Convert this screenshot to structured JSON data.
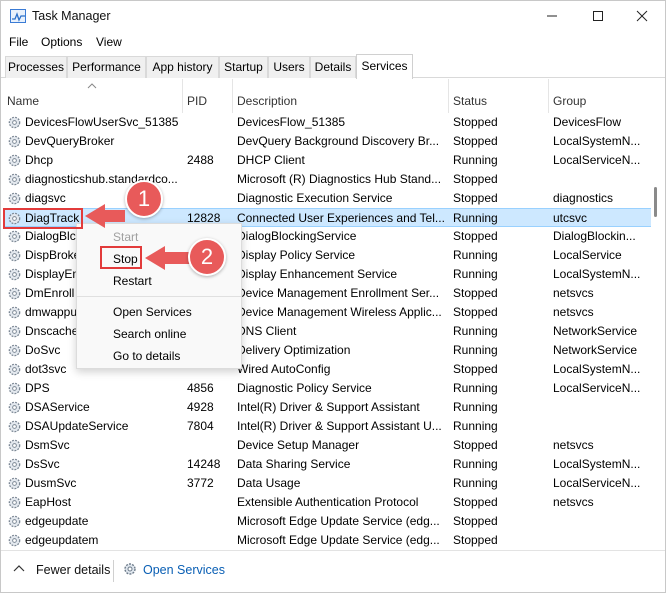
{
  "window": {
    "title": "Task Manager"
  },
  "menu": [
    "File",
    "Options",
    "View"
  ],
  "tabs": [
    {
      "label": "Processes"
    },
    {
      "label": "Performance"
    },
    {
      "label": "App history"
    },
    {
      "label": "Startup"
    },
    {
      "label": "Users"
    },
    {
      "label": "Details"
    },
    {
      "label": "Services",
      "active": true
    }
  ],
  "columns": {
    "name": "Name",
    "pid": "PID",
    "description": "Description",
    "status": "Status",
    "group": "Group"
  },
  "rows": [
    {
      "name": "DevicesFlowUserSvc_51385",
      "pid": "",
      "description": "DevicesFlow_51385",
      "status": "Stopped",
      "group": "DevicesFlow"
    },
    {
      "name": "DevQueryBroker",
      "pid": "",
      "description": "DevQuery Background Discovery Br...",
      "status": "Stopped",
      "group": "LocalSystemN..."
    },
    {
      "name": "Dhcp",
      "pid": "2488",
      "description": "DHCP Client",
      "status": "Running",
      "group": "LocalServiceN..."
    },
    {
      "name": "diagnosticshub.standardco...",
      "pid": "",
      "description": "Microsoft (R) Diagnostics Hub Stand...",
      "status": "Stopped",
      "group": ""
    },
    {
      "name": "diagsvc",
      "pid": "",
      "description": "Diagnostic Execution Service",
      "status": "Stopped",
      "group": "diagnostics"
    },
    {
      "name": "DiagTrack",
      "pid": "12828",
      "description": "Connected User Experiences and Tel...",
      "status": "Running",
      "group": "utcsvc",
      "selected": true
    },
    {
      "name": "DialogBlc",
      "pid": "",
      "description": "DialogBlockingService",
      "status": "Stopped",
      "group": "DialogBlockin..."
    },
    {
      "name": "DispBroke",
      "pid": "",
      "description": "Display Policy Service",
      "status": "Running",
      "group": "LocalService"
    },
    {
      "name": "DisplayEn",
      "pid": "",
      "description": "Display Enhancement Service",
      "status": "Running",
      "group": "LocalSystemN..."
    },
    {
      "name": "DmEnroll",
      "pid": "",
      "description": "Device Management Enrollment Ser...",
      "status": "Stopped",
      "group": "netsvcs"
    },
    {
      "name": "dmwappu",
      "pid": "",
      "description": "Device Management Wireless Applic...",
      "status": "Stopped",
      "group": "netsvcs"
    },
    {
      "name": "Dnscache",
      "pid": "",
      "description": "DNS Client",
      "status": "Running",
      "group": "NetworkService"
    },
    {
      "name": "DoSvc",
      "pid": "",
      "description": "Delivery Optimization",
      "status": "Running",
      "group": "NetworkService"
    },
    {
      "name": "dot3svc",
      "pid": "",
      "description": "Wired AutoConfig",
      "status": "Stopped",
      "group": "LocalSystemN..."
    },
    {
      "name": "DPS",
      "pid": "4856",
      "description": "Diagnostic Policy Service",
      "status": "Running",
      "group": "LocalServiceN..."
    },
    {
      "name": "DSAService",
      "pid": "4928",
      "description": "Intel(R) Driver & Support Assistant",
      "status": "Running",
      "group": ""
    },
    {
      "name": "DSAUpdateService",
      "pid": "7804",
      "description": "Intel(R) Driver & Support Assistant U...",
      "status": "Running",
      "group": ""
    },
    {
      "name": "DsmSvc",
      "pid": "",
      "description": "Device Setup Manager",
      "status": "Stopped",
      "group": "netsvcs"
    },
    {
      "name": "DsSvc",
      "pid": "14248",
      "description": "Data Sharing Service",
      "status": "Running",
      "group": "LocalSystemN..."
    },
    {
      "name": "DusmSvc",
      "pid": "3772",
      "description": "Data Usage",
      "status": "Running",
      "group": "LocalServiceN..."
    },
    {
      "name": "EapHost",
      "pid": "",
      "description": "Extensible Authentication Protocol",
      "status": "Stopped",
      "group": "netsvcs"
    },
    {
      "name": "edgeupdate",
      "pid": "",
      "description": "Microsoft Edge Update Service (edg...",
      "status": "Stopped",
      "group": ""
    },
    {
      "name": "edgeupdatem",
      "pid": "",
      "description": "Microsoft Edge Update Service (edg...",
      "status": "Stopped",
      "group": ""
    }
  ],
  "context_menu": [
    {
      "label": "Start",
      "disabled": true
    },
    {
      "label": "Stop"
    },
    {
      "label": "Restart"
    },
    {
      "label": "Open Services"
    },
    {
      "label": "Search online"
    },
    {
      "label": "Go to details"
    }
  ],
  "footer": {
    "fewer_details": "Fewer details",
    "open_services": "Open Services"
  },
  "callouts": [
    "1",
    "2"
  ],
  "colors": {
    "selection": "#cde8ff",
    "callout": "#e85a5a",
    "link": "#0a5fb4"
  }
}
